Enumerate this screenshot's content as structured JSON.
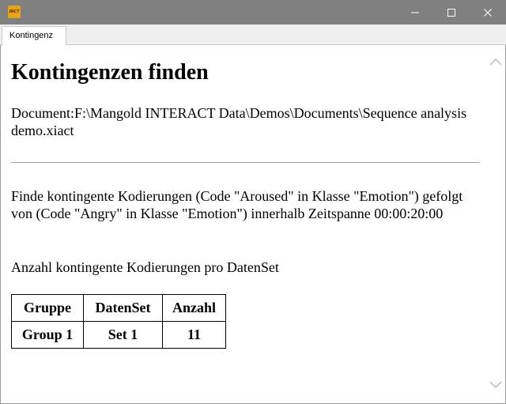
{
  "window": {
    "icon_text": "INCT"
  },
  "tabs": [
    {
      "label": "Kontingenz"
    }
  ],
  "report": {
    "title": "Kontingenzen finden",
    "document_path": "Document:F:\\Mangold INTERACT Data\\Demos\\Documents\\Sequence analysis demo.xiact",
    "description": "Finde kontingente Kodierungen (Code \"Aroused\" in Klasse \"Emotion\") gefolgt von (Code \"Angry\" in Klasse \"Emotion\") innerhalb Zeitspanne 00:00:20:00",
    "table_caption": "Anzahl kontingente Kodierungen pro DatenSet",
    "table": {
      "headers": [
        "Gruppe",
        "DatenSet",
        "Anzahl"
      ],
      "rows": [
        [
          "Group 1",
          "Set 1",
          "11"
        ]
      ]
    }
  },
  "colors": {
    "titlebar": "#808080",
    "tabbar": "#f0f0f0",
    "content_bg": "#ffffff",
    "accent_icon": "#e8a317"
  }
}
